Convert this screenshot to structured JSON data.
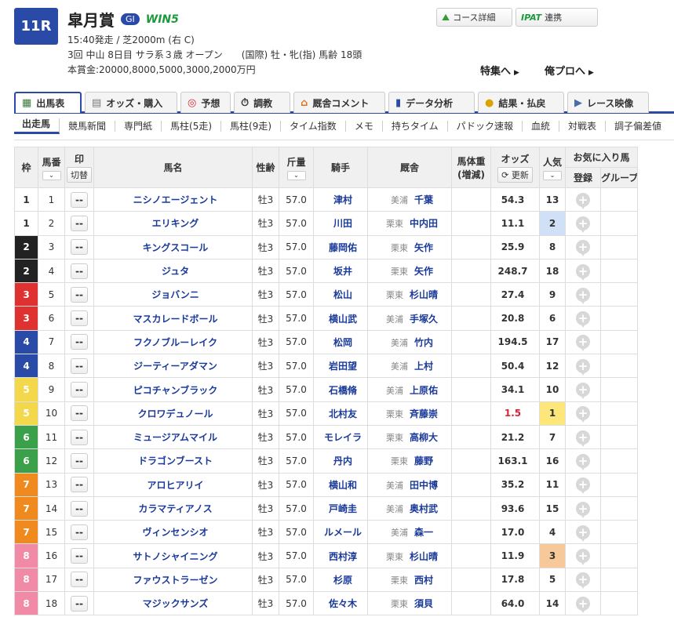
{
  "header": {
    "race_no": "11R",
    "race_name": "皐月賞",
    "grade": "GI",
    "win5": "WIN5",
    "line1": "15:40発走 / 芝2000m (右 C)",
    "line2": "3回 中山 8日目 サラ系３歳 オープン　　(国際) 牡・牝(指) 馬齢 18頭",
    "line3": "本賞金:20000,8000,5000,3000,2000万円",
    "course_btn": "コース詳細",
    "ipat_logo": "IPAT",
    "ipat_btn": "連携",
    "tokushu_link": "特集へ",
    "orepro_link": "俺プロへ"
  },
  "main_tabs": [
    {
      "label": "出馬表",
      "icon": "table-icon"
    },
    {
      "label": "オッズ・購入",
      "icon": "ticket-icon"
    },
    {
      "label": "予想",
      "icon": "target-icon"
    },
    {
      "label": "調教",
      "icon": "stopwatch-icon"
    },
    {
      "label": "厩舎コメント",
      "icon": "stable-icon"
    },
    {
      "label": "データ分析",
      "icon": "bar-chart-icon"
    },
    {
      "label": "結果・払戻",
      "icon": "coins-icon"
    },
    {
      "label": "レース映像",
      "icon": "video-icon"
    }
  ],
  "sub_tabs": [
    "出走馬",
    "競馬新聞",
    "専門紙",
    "馬柱(5走)",
    "馬柱(9走)",
    "タイム指数",
    "メモ",
    "持ちタイム",
    "パドック速報",
    "血統",
    "対戦表",
    "調子偏差値"
  ],
  "table": {
    "headers": {
      "waku": "枠",
      "umaban": "馬番",
      "mark": "印",
      "mark_btn": "切替",
      "horse": "馬名",
      "sex_age": "性齢",
      "weight": "斤量",
      "jockey": "騎手",
      "trainer": "厩舎",
      "body_weight": "馬体重",
      "body_weight_diff": "(増減)",
      "odds": "オッズ",
      "odds_btn": "更新",
      "popularity": "人気",
      "favorite": "お気に入り馬",
      "fav_register": "登録",
      "fav_group": "グループ"
    },
    "rows": [
      {
        "waku": "1",
        "umaban": "1",
        "mark": "--",
        "horse": "ニシノエージェント",
        "sex_age": "牡3",
        "weight": "57.0",
        "jockey": "津村",
        "area": "美浦",
        "trainer": "千葉",
        "odds": "54.3",
        "pop": "13"
      },
      {
        "waku": "1",
        "umaban": "2",
        "mark": "--",
        "horse": "エリキング",
        "sex_age": "牡3",
        "weight": "57.0",
        "jockey": "川田",
        "area": "栗東",
        "trainer": "中内田",
        "odds": "11.1",
        "pop": "2"
      },
      {
        "waku": "2",
        "umaban": "3",
        "mark": "--",
        "horse": "キングスコール",
        "sex_age": "牡3",
        "weight": "57.0",
        "jockey": "藤岡佑",
        "area": "栗東",
        "trainer": "矢作",
        "odds": "25.9",
        "pop": "8"
      },
      {
        "waku": "2",
        "umaban": "4",
        "mark": "--",
        "horse": "ジュタ",
        "sex_age": "牡3",
        "weight": "57.0",
        "jockey": "坂井",
        "area": "栗東",
        "trainer": "矢作",
        "odds": "248.7",
        "pop": "18"
      },
      {
        "waku": "3",
        "umaban": "5",
        "mark": "--",
        "horse": "ジョバンニ",
        "sex_age": "牡3",
        "weight": "57.0",
        "jockey": "松山",
        "area": "栗東",
        "trainer": "杉山晴",
        "odds": "27.4",
        "pop": "9"
      },
      {
        "waku": "3",
        "umaban": "6",
        "mark": "--",
        "horse": "マスカレードボール",
        "sex_age": "牡3",
        "weight": "57.0",
        "jockey": "横山武",
        "area": "美浦",
        "trainer": "手塚久",
        "odds": "20.8",
        "pop": "6"
      },
      {
        "waku": "4",
        "umaban": "7",
        "mark": "--",
        "horse": "フクノブルーレイク",
        "sex_age": "牡3",
        "weight": "57.0",
        "jockey": "松岡",
        "area": "美浦",
        "trainer": "竹内",
        "odds": "194.5",
        "pop": "17"
      },
      {
        "waku": "4",
        "umaban": "8",
        "mark": "--",
        "horse": "ジーティーアダマン",
        "sex_age": "牡3",
        "weight": "57.0",
        "jockey": "岩田望",
        "area": "美浦",
        "trainer": "上村",
        "odds": "50.4",
        "pop": "12"
      },
      {
        "waku": "5",
        "umaban": "9",
        "mark": "--",
        "horse": "ピコチャンブラック",
        "sex_age": "牡3",
        "weight": "57.0",
        "jockey": "石橋脩",
        "area": "美浦",
        "trainer": "上原佑",
        "odds": "34.1",
        "pop": "10"
      },
      {
        "waku": "5",
        "umaban": "10",
        "mark": "--",
        "horse": "クロワデュノール",
        "sex_age": "牡3",
        "weight": "57.0",
        "jockey": "北村友",
        "area": "栗東",
        "trainer": "斉藤崇",
        "odds": "1.5",
        "pop": "1"
      },
      {
        "waku": "6",
        "umaban": "11",
        "mark": "--",
        "horse": "ミュージアムマイル",
        "sex_age": "牡3",
        "weight": "57.0",
        "jockey": "モレイラ",
        "area": "栗東",
        "trainer": "高柳大",
        "odds": "21.2",
        "pop": "7"
      },
      {
        "waku": "6",
        "umaban": "12",
        "mark": "--",
        "horse": "ドラゴンブースト",
        "sex_age": "牡3",
        "weight": "57.0",
        "jockey": "丹内",
        "area": "栗東",
        "trainer": "藤野",
        "odds": "163.1",
        "pop": "16"
      },
      {
        "waku": "7",
        "umaban": "13",
        "mark": "--",
        "horse": "アロヒアリイ",
        "sex_age": "牡3",
        "weight": "57.0",
        "jockey": "横山和",
        "area": "美浦",
        "trainer": "田中博",
        "odds": "35.2",
        "pop": "11"
      },
      {
        "waku": "7",
        "umaban": "14",
        "mark": "--",
        "horse": "カラマティアノス",
        "sex_age": "牡3",
        "weight": "57.0",
        "jockey": "戸崎圭",
        "area": "美浦",
        "trainer": "奥村武",
        "odds": "93.6",
        "pop": "15"
      },
      {
        "waku": "7",
        "umaban": "15",
        "mark": "--",
        "horse": "ヴィンセンシオ",
        "sex_age": "牡3",
        "weight": "57.0",
        "jockey": "ルメール",
        "area": "美浦",
        "trainer": "森一",
        "odds": "17.0",
        "pop": "4"
      },
      {
        "waku": "8",
        "umaban": "16",
        "mark": "--",
        "horse": "サトノシャイニング",
        "sex_age": "牡3",
        "weight": "57.0",
        "jockey": "西村淳",
        "area": "栗東",
        "trainer": "杉山晴",
        "odds": "11.9",
        "pop": "3"
      },
      {
        "waku": "8",
        "umaban": "17",
        "mark": "--",
        "horse": "ファウストラーゼン",
        "sex_age": "牡3",
        "weight": "57.0",
        "jockey": "杉原",
        "area": "栗東",
        "trainer": "西村",
        "odds": "17.8",
        "pop": "5"
      },
      {
        "waku": "8",
        "umaban": "18",
        "mark": "--",
        "horse": "マジックサンズ",
        "sex_age": "牡3",
        "weight": "57.0",
        "jockey": "佐々木",
        "area": "栗東",
        "trainer": "須貝",
        "odds": "64.0",
        "pop": "14"
      }
    ]
  },
  "colors": {
    "accent": "#2a4aa8",
    "waku": {
      "1": "#ffffff",
      "2": "#222222",
      "3": "#e03131",
      "4": "#2a4aa8",
      "5": "#f2d84a",
      "6": "#3aa04a",
      "7": "#f08a1e",
      "8": "#f08aa6"
    },
    "waku_text": {
      "1": "#333333",
      "5": "#ffffff"
    }
  }
}
